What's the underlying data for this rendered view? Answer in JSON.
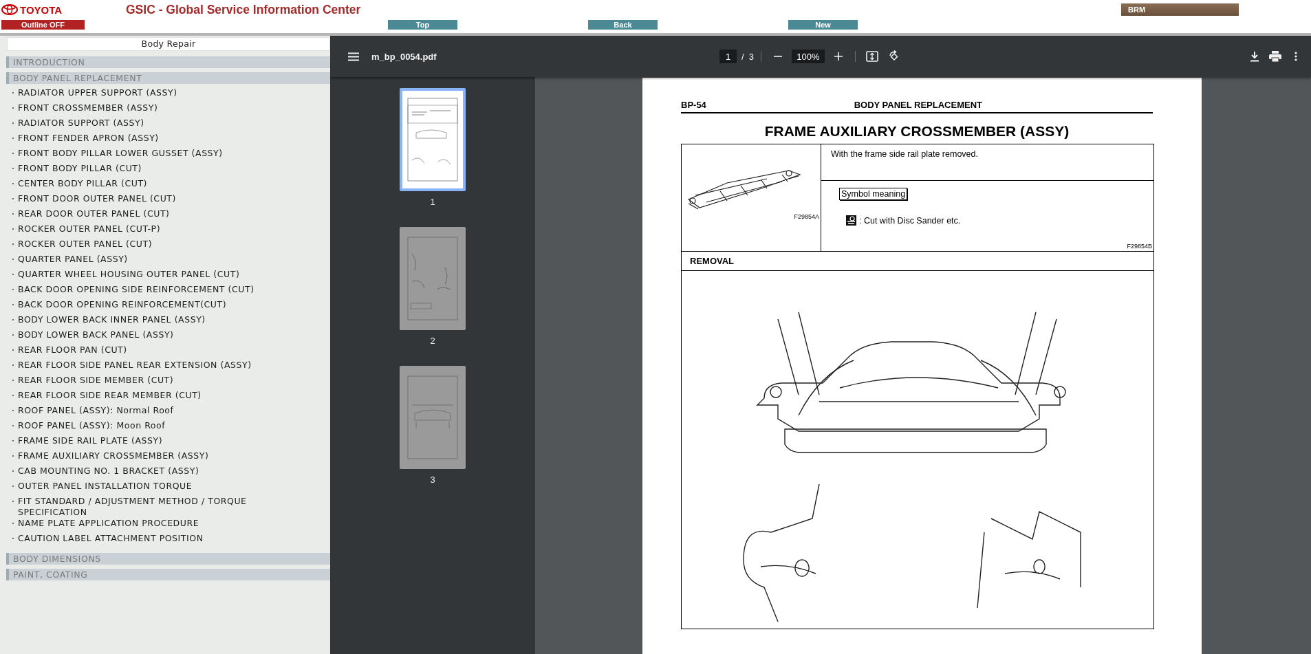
{
  "header": {
    "logo_text": "TOYOTA",
    "outline_button": "Outline OFF",
    "title": "GSIC - Global Service Information Center",
    "nav_buttons": [
      "Top",
      "Back",
      "New"
    ],
    "brm_button": "BRM"
  },
  "sidebar": {
    "title": "Body Repair",
    "sections": [
      {
        "label": "INTRODUCTION"
      },
      {
        "label": "BODY PANEL REPLACEMENT",
        "items": [
          "RADIATOR UPPER SUPPORT (ASSY)",
          "FRONT CROSSMEMBER (ASSY)",
          "RADIATOR SUPPORT (ASSY)",
          "FRONT FENDER APRON (ASSY)",
          "FRONT BODY PILLAR LOWER GUSSET (ASSY)",
          "FRONT BODY PILLAR (CUT)",
          "CENTER BODY PILLAR (CUT)",
          "FRONT DOOR OUTER PANEL (CUT)",
          "REAR DOOR OUTER PANEL (CUT)",
          "ROCKER OUTER PANEL (CUT-P)",
          "ROCKER OUTER PANEL (CUT)",
          "QUARTER PANEL (ASSY)",
          "QUARTER WHEEL HOUSING OUTER PANEL (CUT)",
          "BACK DOOR OPENING SIDE REINFORCEMENT (CUT)",
          "BACK DOOR OPENING REINFORCEMENT(CUT)",
          "BODY LOWER BACK INNER PANEL (ASSY)",
          "BODY LOWER BACK PANEL (ASSY)",
          "REAR FLOOR PAN (CUT)",
          "REAR FLOOR SIDE PANEL REAR EXTENSION (ASSY)",
          "REAR FLOOR SIDE MEMBER (CUT)",
          "REAR FLOOR SIDE REAR MEMBER (CUT)",
          "ROOF PANEL (ASSY): Normal Roof",
          "ROOF PANEL (ASSY): Moon Roof",
          "FRAME SIDE RAIL PLATE (ASSY)",
          "FRAME AUXILIARY CROSSMEMBER (ASSY)",
          "CAB MOUNTING NO. 1 BRACKET (ASSY)",
          "OUTER PANEL INSTALLATION TORQUE",
          "FIT STANDARD / ADJUSTMENT METHOD / TORQUE SPECIFICATION",
          "NAME PLATE APPLICATION PROCEDURE",
          "CAUTION LABEL ATTACHMENT POSITION"
        ]
      },
      {
        "label": "BODY DIMENSIONS"
      },
      {
        "label": "PAINT, COATING"
      }
    ]
  },
  "viewer": {
    "filename": "m_bp_0054.pdf",
    "page_current": "1",
    "page_separator": "/",
    "page_total": "3",
    "zoom": "100%",
    "thumbnails": [
      {
        "label": "1",
        "selected": true
      },
      {
        "label": "2",
        "selected": false
      },
      {
        "label": "3",
        "selected": false
      }
    ]
  },
  "document": {
    "page_code": "BP-54",
    "section_header": "BODY PANEL REPLACEMENT",
    "title": "FRAME AUXILIARY CROSSMEMBER (ASSY)",
    "note": "With the frame side rail plate removed.",
    "symbol_heading": "Symbol meaning",
    "symbol_text": ": Cut with Disc Sander etc.",
    "figure_a": "F29854A",
    "figure_b": "F29854B",
    "step_heading": "REMOVAL"
  }
}
